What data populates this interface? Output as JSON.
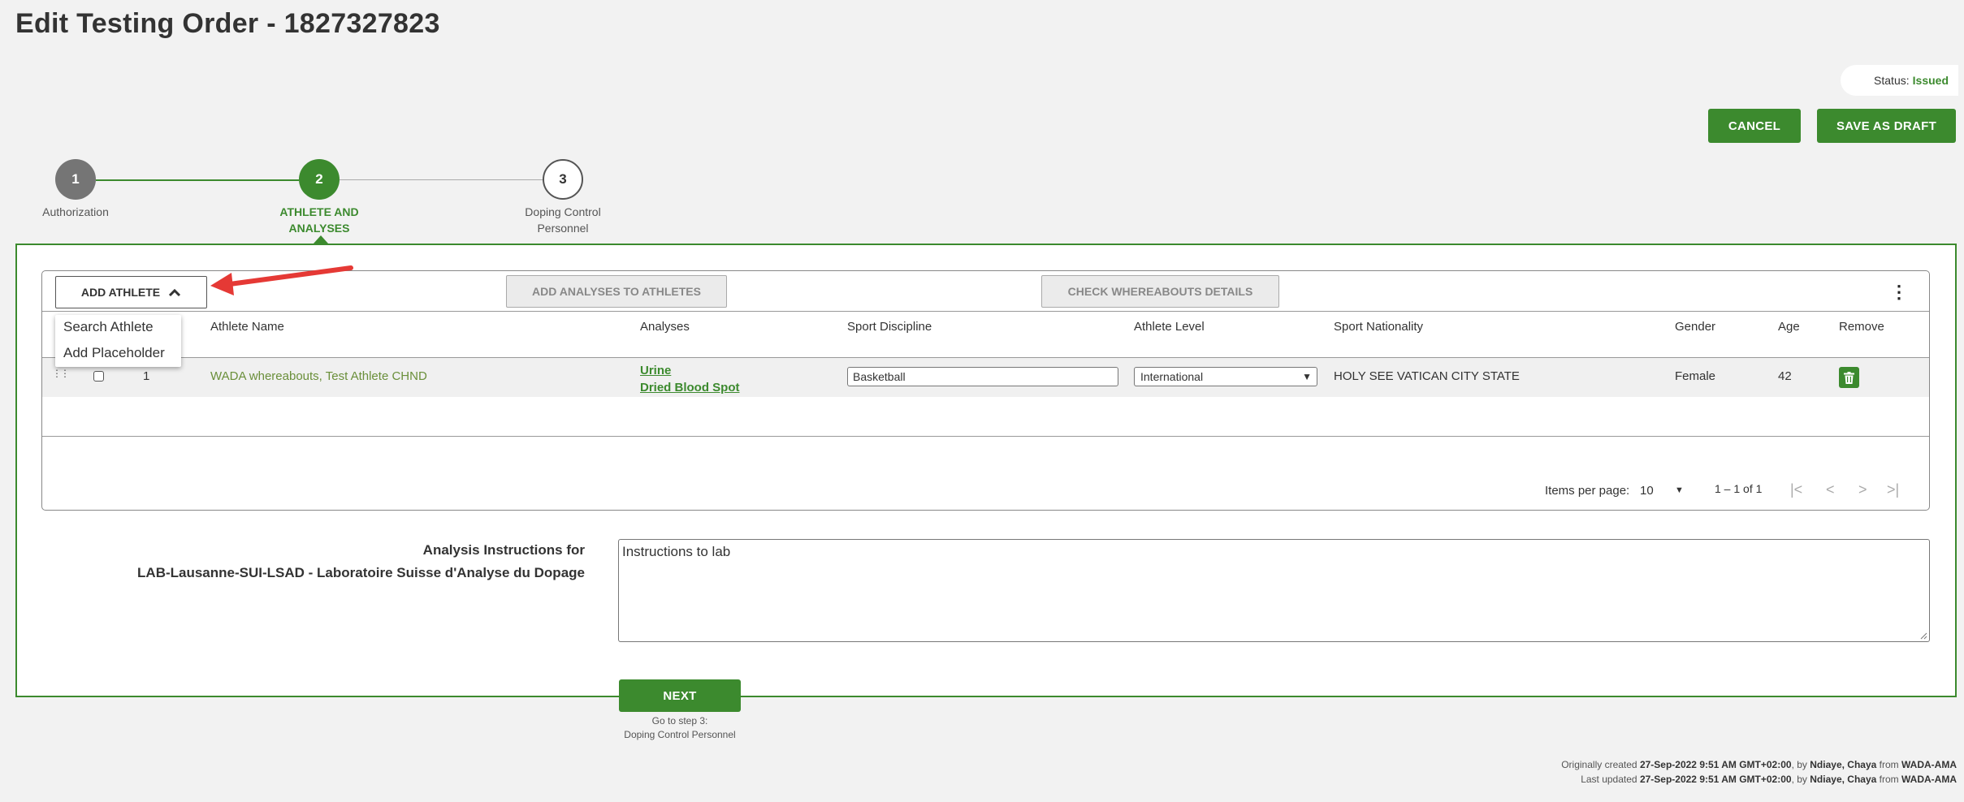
{
  "page": {
    "title": "Edit Testing Order - 1827327823"
  },
  "status": {
    "label": "Status:",
    "value": "Issued"
  },
  "actions": {
    "cancel_label": "CANCEL",
    "save_draft_label": "SAVE AS DRAFT"
  },
  "stepper": {
    "steps": [
      {
        "number": "1",
        "label": "Authorization",
        "state": "done"
      },
      {
        "number": "2",
        "label": "ATHLETE AND ANALYSES",
        "state": "active"
      },
      {
        "number": "3",
        "label": "Doping Control Personnel",
        "state": "pending"
      }
    ]
  },
  "toolbar": {
    "add_athlete_label": "ADD ATHLETE",
    "add_analyses_label": "ADD ANALYSES TO ATHLETES",
    "check_whereabouts_label": "CHECK WHEREABOUTS DETAILS"
  },
  "dropdown": {
    "items": [
      "Search Athlete",
      "Add Placeholder"
    ]
  },
  "table": {
    "columns": [
      "Athlete Name",
      "Analyses",
      "Sport Discipline",
      "Athlete Level",
      "Sport Nationality",
      "Gender",
      "Age",
      "Remove"
    ],
    "rows": [
      {
        "number": "1",
        "athlete_name": "WADA whereabouts, Test Athlete CHND",
        "analyses": [
          "Urine",
          "Dried Blood Spot"
        ],
        "sport_discipline": "Basketball",
        "athlete_level": "International",
        "sport_nationality": "HOLY SEE VATICAN CITY STATE",
        "gender": "Female",
        "age": "42"
      }
    ]
  },
  "pagination": {
    "items_per_page_label": "Items per page:",
    "items_per_page": "10",
    "range": "1 – 1 of 1"
  },
  "instructions": {
    "label_line1": "Analysis Instructions for",
    "label_line2": "LAB-Lausanne-SUI-LSAD - Laboratoire Suisse d'Analyse du Dopage",
    "value": "Instructions to lab"
  },
  "next": {
    "label": "NEXT",
    "caption_line1": "Go to step 3:",
    "caption_line2": "Doping Control Personnel"
  },
  "footer": {
    "created_prefix": "Originally created",
    "created_date": "27-Sep-2022 9:51 AM GMT+02:00",
    "created_by_word": ", by",
    "created_by": "Ndiaye, Chaya",
    "created_from_word": "from",
    "created_org": "WADA-AMA",
    "updated_prefix": "Last updated",
    "updated_date": "27-Sep-2022 9:51 AM GMT+02:00",
    "updated_by_word": ", by",
    "updated_by": "Ndiaye, Chaya",
    "updated_from_word": "from",
    "updated_org": "WADA-AMA"
  },
  "colors": {
    "brand_green": "#3c8a2e",
    "step_done": "#757575",
    "annotation_red": "#e53935"
  }
}
